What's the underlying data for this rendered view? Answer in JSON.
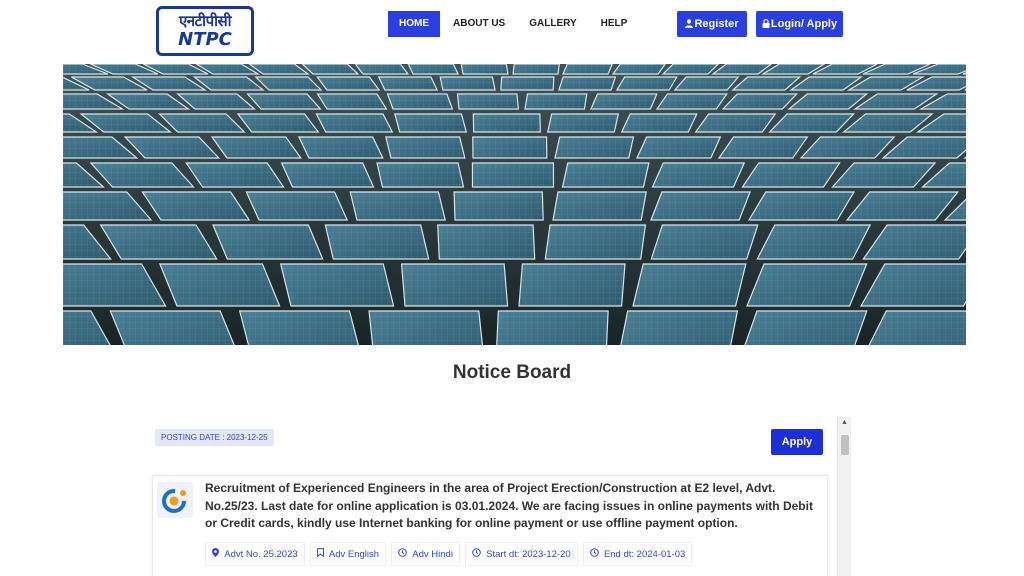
{
  "header": {
    "logo_hindi": "एनटीपीसी",
    "logo_english": "NTPC",
    "nav": [
      {
        "label": "HOME",
        "active": true
      },
      {
        "label": "ABOUT US",
        "active": false
      },
      {
        "label": "GALLERY",
        "active": false
      },
      {
        "label": "HELP",
        "active": false
      }
    ],
    "register_label": "Register",
    "login_label": "Login/ Apply",
    "register_icon": "user-icon",
    "login_icon": "lock-icon"
  },
  "banner": {
    "image": "solar-panels-photo"
  },
  "notice_board": {
    "title": "Notice Board",
    "posting_date": "POSTING DATE : 2023-12-25",
    "apply_label": "Apply",
    "notice": {
      "text": "Recruitment of Experienced Engineers in the area of Project Erection/Construction at E2 level, Advt. No.25/23. Last date for online application is 03.01.2024. We are facing issues in online payments with Debit or Credit cards, kindly use Internet banking for online payment or use offline payment option.",
      "tags": [
        {
          "icon": "map-marker-icon",
          "label": "Advt No. 25.2023"
        },
        {
          "icon": "bookmark-icon",
          "label": "Adv English"
        },
        {
          "icon": "clock-icon",
          "label": "Adv Hindi"
        },
        {
          "icon": "clock-icon",
          "label": "Start dt: 2023-12-20"
        },
        {
          "icon": "clock-icon",
          "label": "End dt: 2024-01-03"
        }
      ]
    }
  },
  "colors": {
    "primary": "#2b3fe0",
    "logo": "#1a3a8f",
    "tag_text": "#3347d3"
  }
}
